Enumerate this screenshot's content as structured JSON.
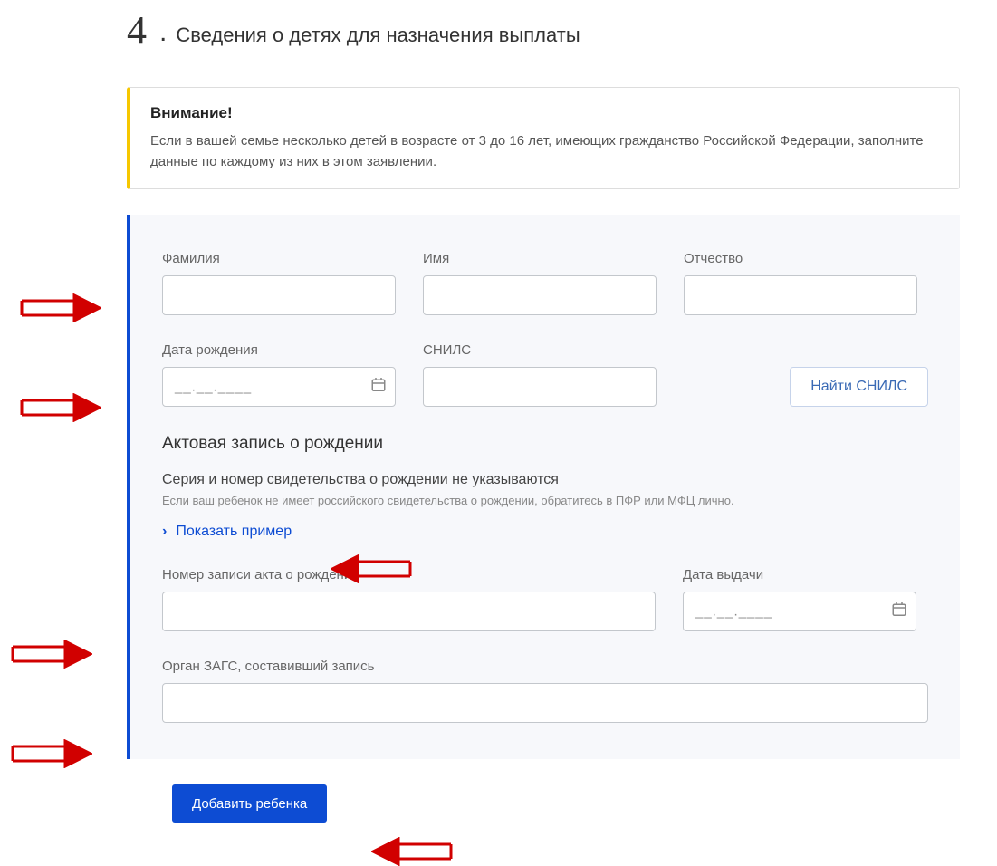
{
  "step_number": "4",
  "step_dot": ".",
  "step_title": "Сведения о детях для назначения выплаты",
  "warning": {
    "title": "Внимание!",
    "text": "Если в вашей семье несколько детей в возрасте от 3 до 16 лет, имеющих гражданство Российской Федерации, заполните данные по каждому из них в этом заявлении."
  },
  "labels": {
    "last_name": "Фамилия",
    "first_name": "Имя",
    "patronymic": "Отчество",
    "dob": "Дата рождения",
    "snils": "СНИЛС",
    "find_snils": "Найти СНИЛС",
    "date_placeholder": "__.__.____",
    "birth_record_heading": "Актовая запись о рождении",
    "birth_record_sub1": "Серия и номер свидетельства о рождении не указываются",
    "birth_record_sub2": "Если ваш ребенок не имеет российского свидетельства о рождении, обратитесь в ПФР или МФЦ лично.",
    "show_example": "Показать пример",
    "record_number": "Номер записи акта о рождении",
    "issue_date": "Дата выдачи",
    "zags_body": "Орган ЗАГС, составивший запись",
    "add_child": "Добавить ребенка"
  }
}
